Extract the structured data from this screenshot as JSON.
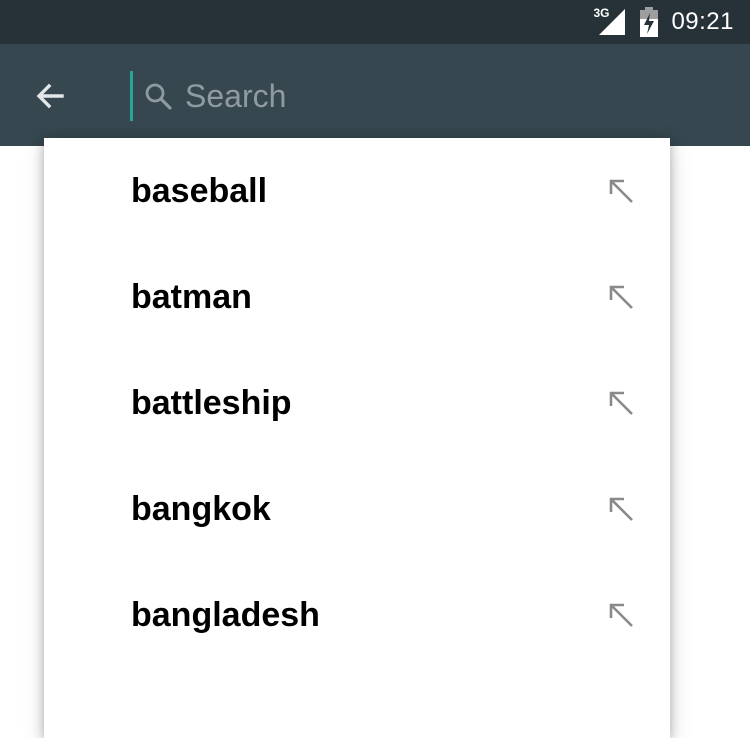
{
  "status_bar": {
    "network": "3G",
    "time": "09:21"
  },
  "toolbar": {
    "back_icon": "arrow-back-icon",
    "search_placeholder": "Search",
    "search_value": ""
  },
  "suggestions": [
    {
      "label": "baseball",
      "icon": "arrow-up-left-icon"
    },
    {
      "label": "batman",
      "icon": "arrow-up-left-icon"
    },
    {
      "label": "battleship",
      "icon": "arrow-up-left-icon"
    },
    {
      "label": "bangkok",
      "icon": "arrow-up-left-icon"
    },
    {
      "label": "bangladesh",
      "icon": "arrow-up-left-icon"
    }
  ],
  "colors": {
    "status_bar": "#263238",
    "toolbar": "#37474f",
    "accent": "#26a69a"
  }
}
